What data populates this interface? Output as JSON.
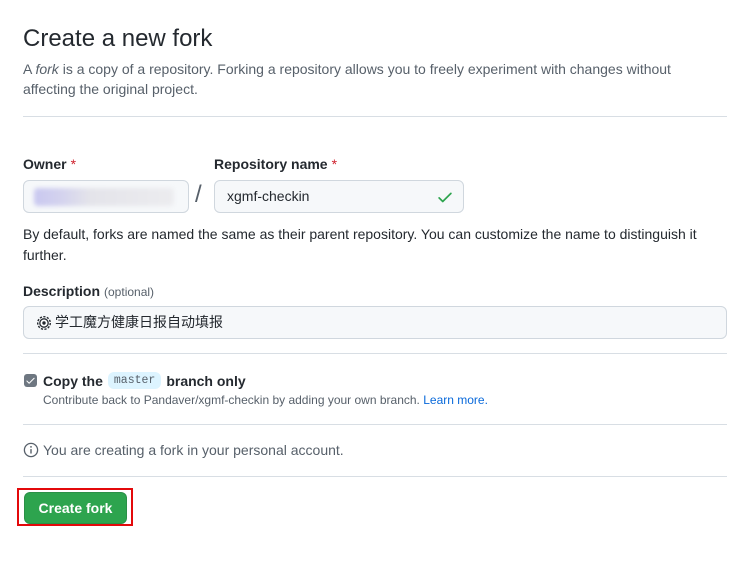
{
  "header": {
    "title": "Create a new fork",
    "subtitle_prefix": "A ",
    "subtitle_em": "fork",
    "subtitle_rest": " is a copy of a repository. Forking a repository allows you to freely experiment with changes without affecting the original project."
  },
  "owner": {
    "label": "Owner",
    "required_mark": "*"
  },
  "repo": {
    "label": "Repository name",
    "required_mark": "*",
    "slash": "/",
    "value": "xgmf-checkin",
    "valid_icon": "check-icon"
  },
  "help_text": "By default, forks are named the same as their parent repository. You can customize the name to distinguish it further.",
  "description": {
    "label": "Description",
    "optional": "(optional)",
    "value": "学工魔方健康日报自动填报",
    "emoji_icon": "gear-emoji-icon"
  },
  "copy_branch": {
    "checked": true,
    "label_prefix": "Copy the",
    "branch": "master",
    "label_suffix": "branch only",
    "contrib_text": "Contribute back to Pandaver/xgmf-checkin by adding your own branch.",
    "learn_more": "Learn more."
  },
  "info": {
    "icon": "info-icon",
    "text": "You are creating a fork in your personal account."
  },
  "create_button": {
    "label": "Create fork"
  },
  "colors": {
    "primary_button": "#2da44e",
    "required": "#cf222e",
    "link": "#0969da",
    "highlight": "#e3090b"
  }
}
